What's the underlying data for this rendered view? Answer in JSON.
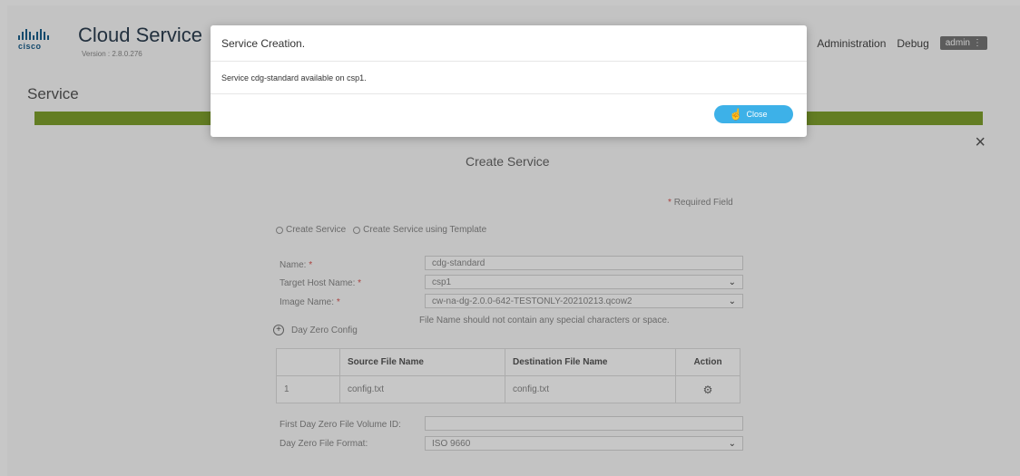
{
  "header": {
    "logo_text": "cisco",
    "title": "Cloud Service",
    "version": "Version : 2.8.0.276",
    "nav": {
      "administration": "Administration",
      "debug": "Debug",
      "user": "admin",
      "user_menu_icon": "⋮"
    }
  },
  "page": {
    "title": "Service"
  },
  "form": {
    "title": "Create Service",
    "required_star": "*",
    "required_label": "Required Field",
    "close_icon": "×",
    "radio_options": [
      "Create Service",
      "Create Service using Template"
    ],
    "name_label": "Name:",
    "name_value": "cdg-standard",
    "target_label": "Target Host Name:",
    "target_value": "csp1",
    "image_label": "Image Name:",
    "image_value": "cw-na-dg-2.0.0-642-TESTONLY-20210213.qcow2",
    "image_hint": "File Name should not contain any special characters or space.",
    "day_zero_label": "Day Zero Config",
    "plus_icon": "+",
    "table": {
      "headers": [
        "",
        "Source File Name",
        "Destination File Name",
        "Action"
      ],
      "rows": [
        {
          "index": "1",
          "source": "config.txt",
          "destination": "config.txt"
        }
      ]
    },
    "volume_label": "First Day Zero File Volume ID:",
    "volume_value": "",
    "format_label": "Day Zero File Format:",
    "format_value": "ISO 9660",
    "chevron": "⌄"
  },
  "modal": {
    "title": "Service Creation.",
    "message": "Service cdg-standard available on csp1.",
    "close_label": "Close"
  },
  "colors": {
    "accent": "#3db1e8",
    "green_bar": "#7fa02e",
    "brand": "#1a5f8c"
  }
}
